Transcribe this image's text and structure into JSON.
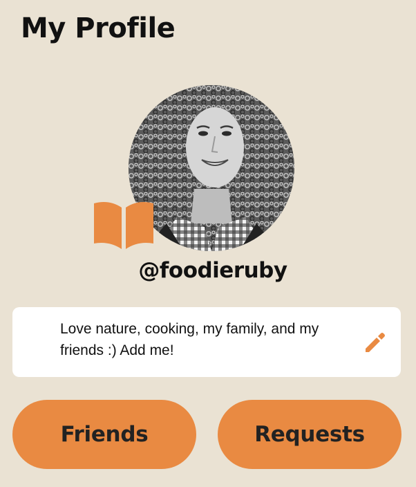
{
  "header": {
    "title": "My Profile"
  },
  "profile": {
    "handle": "@foodieruby",
    "avatar_icon": "profile-photo",
    "badge_icon": "open-book-icon",
    "bio": "Love nature, cooking, my family, and my friends :) Add me!",
    "edit_icon": "pencil-icon"
  },
  "actions": {
    "friends_label": "Friends",
    "requests_label": "Requests"
  },
  "colors": {
    "background": "#eae2d3",
    "accent": "#e98a42",
    "card": "#ffffff",
    "text": "#111111"
  }
}
